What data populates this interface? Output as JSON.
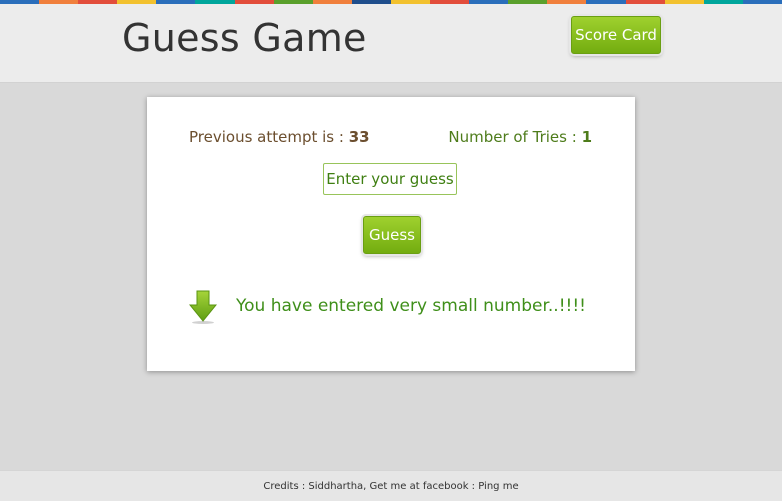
{
  "colors": {
    "accent_green": "#8cc21f",
    "message_green": "#3f8f1a",
    "brown_text": "#6b4e2e",
    "top_strip": [
      "#2a6ebb",
      "#f07f3c",
      "#e24d3b",
      "#f2c12e",
      "#2a6ebb",
      "#00a69c",
      "#e24d3b",
      "#5aa02c",
      "#f07f3c",
      "#1f4e8c",
      "#f2c12e",
      "#e24d3b",
      "#2a6ebb",
      "#5aa02c",
      "#f07f3c",
      "#2a6ebb",
      "#e24d3b",
      "#f2c12e",
      "#00a69c",
      "#2a6ebb"
    ]
  },
  "header": {
    "title": "Guess Game",
    "score_card_label": "Score Card"
  },
  "game": {
    "previous_label": "Previous attempt is :",
    "previous_value": "33",
    "tries_label": "Number of Tries :",
    "tries_value": "1",
    "input_placeholder": "Enter your guess",
    "input_value": "",
    "guess_label": "Guess",
    "feedback_icon": "down-arrow-icon",
    "message": "You have entered very small number..!!!!"
  },
  "footer": {
    "credits_text": "Credits : Siddhartha, Get me at facebook :",
    "ping_link": "Ping me"
  }
}
